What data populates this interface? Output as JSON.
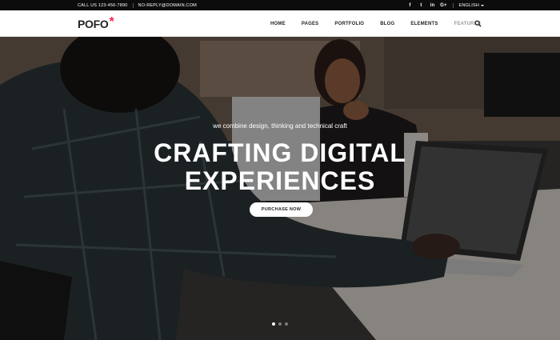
{
  "topbar": {
    "phone": "CALL US 123-456-7890",
    "email": "NO-REPLY@DOMAIN.COM",
    "social": [
      "f",
      "t",
      "in",
      "G+"
    ],
    "language": "ENGLISH"
  },
  "nav": {
    "logo": "POFO",
    "logo_mark": "*",
    "items": [
      "HOME",
      "PAGES",
      "PORTFOLIO",
      "BLOG",
      "ELEMENTS",
      "FEATURES"
    ]
  },
  "hero": {
    "tagline": "we combine design, thinking and technical craft",
    "headline_line1": "CRAFTING DIGITAL",
    "headline_line2": "EXPERIENCES",
    "cta": "PURCHASE NOW"
  },
  "colors": {
    "accent": "#ff214f",
    "topbar": "#0c0c0c",
    "text": "#232323"
  }
}
